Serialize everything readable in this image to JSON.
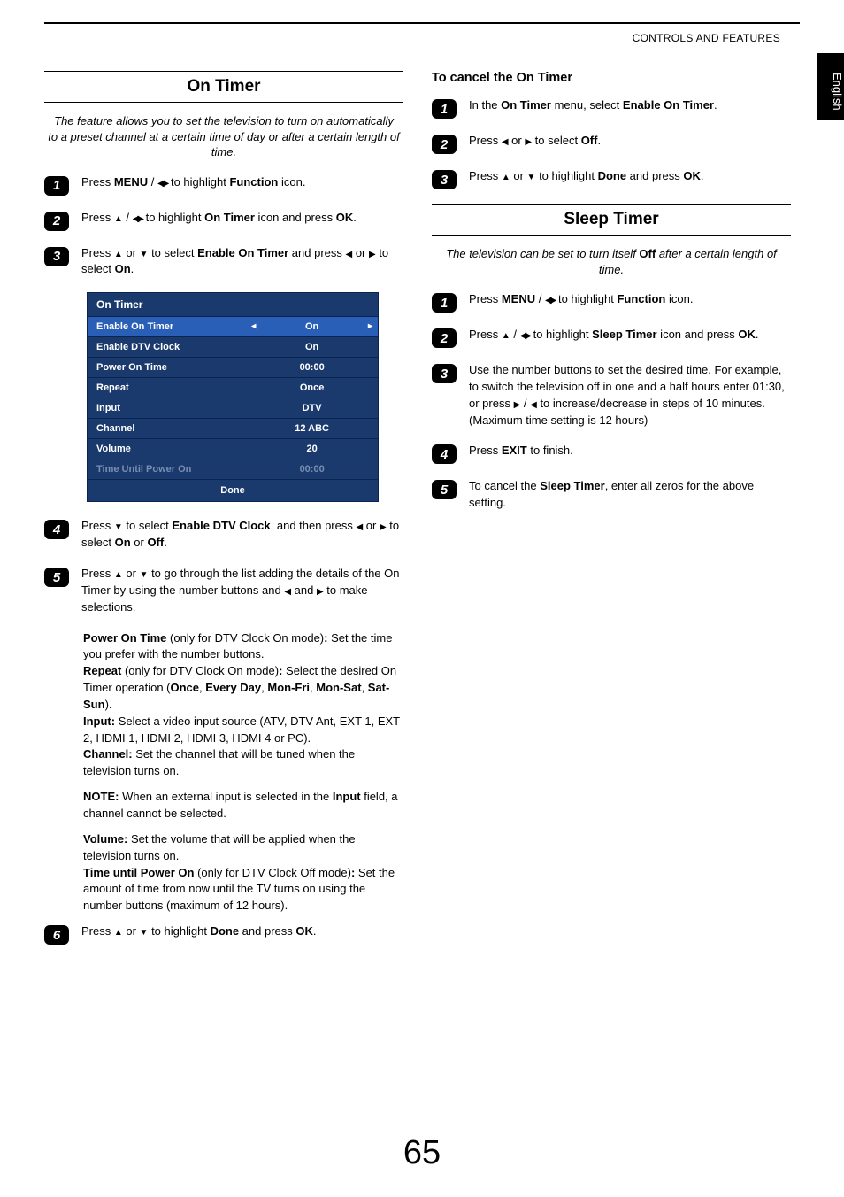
{
  "header": {
    "section": "CONTROLS AND FEATURES",
    "language_tab": "English"
  },
  "page_number": "65",
  "left": {
    "title": "On Timer",
    "intro": "The feature allows you to set the television to turn on automatically to a preset channel at a certain time of day or after a certain length of time.",
    "steps": {
      "s1a": "Press ",
      "s1b": "MENU",
      "s1c": " / ",
      "s1d": " to highlight ",
      "s1e": "Function",
      "s1f": " icon.",
      "s2a": "Press ",
      "s2b": " / ",
      "s2c": " to highlight ",
      "s2d": "On Timer",
      "s2e": " icon and press ",
      "s2f": "OK",
      "s2g": ".",
      "s3a": "Press ",
      "s3b": " or ",
      "s3c": " to select ",
      "s3d": "Enable On Timer",
      "s3e": " and press ",
      "s3f": " or ",
      "s3g": " to select ",
      "s3h": "On",
      "s3i": ".",
      "s4a": "Press ",
      "s4b": " to select ",
      "s4c": "Enable DTV Clock",
      "s4d": ", and then press ",
      "s4e": " or ",
      "s4f": " to select ",
      "s4g": "On",
      "s4h": " or ",
      "s4i": "Off",
      "s4j": ".",
      "s5a": "Press ",
      "s5b": " or ",
      "s5c": " to go through the list adding the details of the On Timer by using the number buttons and ",
      "s5d": " and ",
      "s5e": " to make selections.",
      "s6a": "Press ",
      "s6b": " or ",
      "s6c": " to highlight ",
      "s6d": "Done",
      "s6e": " and press ",
      "s6f": "OK",
      "s6g": "."
    },
    "details": {
      "p1a": "Power On Time",
      "p1b": " (only for DTV Clock On mode)",
      "p1c": ":",
      "p1d": " Set the time you prefer with the number buttons.",
      "p2a": "Repeat",
      "p2b": " (only for DTV Clock On mode)",
      "p2c": ":",
      "p2d": " Select the desired On Timer operation (",
      "p2e": "Once",
      "p2f": ", ",
      "p2g": "Every Day",
      "p2h": ", ",
      "p2i": "Mon-Fri",
      "p2j": ", ",
      "p2k": "Mon-Sat",
      "p2l": ", ",
      "p2m": "Sat-Sun",
      "p2n": ").",
      "p3a": "Input:",
      "p3b": " Select a video input source (ATV, DTV Ant, EXT 1, EXT 2, HDMI 1, HDMI 2, HDMI 3, HDMI 4 or PC).",
      "p4a": "Channel:",
      "p4b": " Set the channel that will be tuned when the television turns on.",
      "note_a": "NOTE:",
      "note_b": " When an external input is selected in the ",
      "note_c": "Input",
      "note_d": " field, a channel cannot be selected.",
      "p5a": "Volume:",
      "p5b": " Set the volume that will be applied when the television turns on.",
      "p6a": "Time until Power On",
      "p6b": " (only for DTV Clock Off mode)",
      "p6c": ":",
      "p6d": " Set the amount of time from now until the TV turns on using the number buttons (maximum of 12 hours)."
    },
    "osd": {
      "title": "On Timer",
      "rows": [
        {
          "label": "Enable On Timer",
          "value": "On",
          "highlight": true
        },
        {
          "label": "Enable DTV Clock",
          "value": "On"
        },
        {
          "label": "Power On Time",
          "value": "00:00"
        },
        {
          "label": "Repeat",
          "value": "Once"
        },
        {
          "label": "Input",
          "value": "DTV"
        },
        {
          "label": "Channel",
          "value": "12 ABC"
        },
        {
          "label": "Volume",
          "value": "20"
        },
        {
          "label": "Time Until Power On",
          "value": "00:00",
          "disabled": true
        }
      ],
      "done": "Done"
    }
  },
  "right": {
    "cancel_title": "To cancel the On Timer",
    "cancel": {
      "s1a": "In the ",
      "s1b": "On Timer",
      "s1c": " menu, select ",
      "s1d": "Enable On Timer",
      "s1e": ".",
      "s2a": "Press ",
      "s2b": " or ",
      "s2c": " to select ",
      "s2d": "Off",
      "s2e": ".",
      "s3a": "Press ",
      "s3b": " or ",
      "s3c": " to highlight ",
      "s3d": "Done",
      "s3e": " and press ",
      "s3f": "OK",
      "s3g": "."
    },
    "sleep_title": "Sleep Timer",
    "sleep_intro_a": "The television can be set to turn itself ",
    "sleep_intro_b": "Off",
    "sleep_intro_c": " after a certain length of time.",
    "sleep": {
      "s1a": "Press ",
      "s1b": "MENU",
      "s1c": " / ",
      "s1d": " to highlight ",
      "s1e": "Function",
      "s1f": " icon.",
      "s2a": "Press ",
      "s2b": " / ",
      "s2c": " to highlight ",
      "s2d": "Sleep Timer",
      "s2e": " icon and press ",
      "s2f": "OK",
      "s2g": ".",
      "s3a": "Use the number buttons to set the desired time. For example, to switch the television off in one and a half hours enter 01:30, or press ",
      "s3b": " / ",
      "s3c": " to increase/decrease in steps of 10 minutes. (Maximum time setting is 12 hours)",
      "s4a": "Press ",
      "s4b": "EXIT",
      "s4c": " to finish.",
      "s5a": "To cancel the ",
      "s5b": "Sleep Timer",
      "s5c": ", enter all zeros for the above setting."
    }
  }
}
